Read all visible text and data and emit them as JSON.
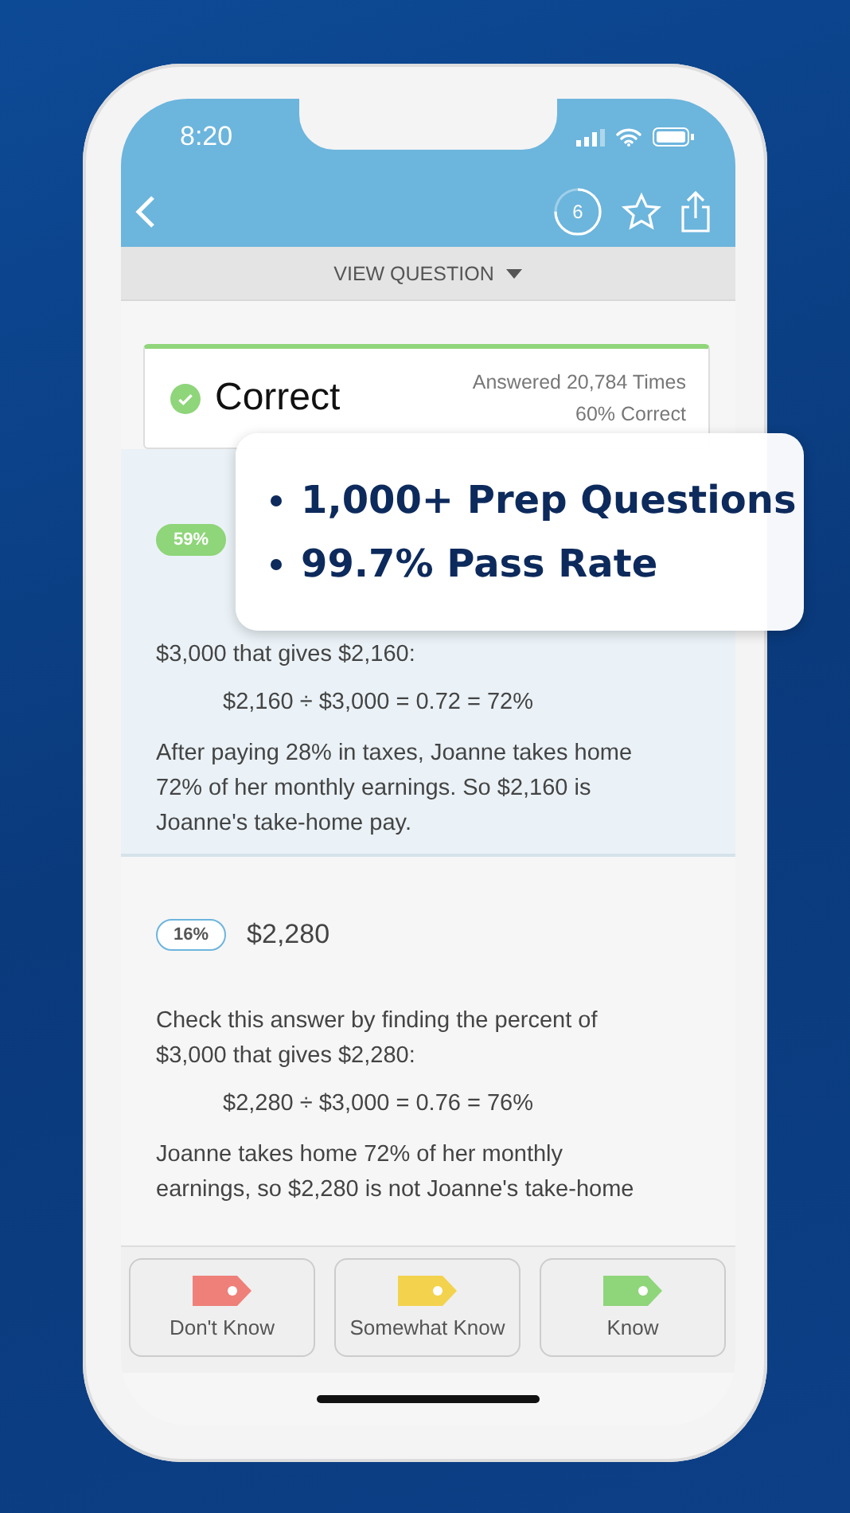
{
  "status_bar": {
    "time": "8:20"
  },
  "nav": {
    "progress_label": "6",
    "level": 0.75
  },
  "view_bar": {
    "label": "VIEW QUESTION"
  },
  "result": {
    "label": "Correct",
    "answered": "Answered 20,784 Times",
    "percent_correct": "60% Correct"
  },
  "answers": [
    {
      "percent": "59%",
      "correct": true,
      "selected": true,
      "check": "$3,000 that gives $2,160:",
      "equation": "$2,160 ÷ $3,000 = 0.72 = 72%",
      "explanation": "After paying 28% in taxes, Joanne takes home 72% of her monthly earnings. So $2,160 is Joanne's take-home pay."
    },
    {
      "percent": "16%",
      "amount": "$2,280",
      "correct": false,
      "selected": false,
      "check": "Check this answer by finding the percent of $3,000 that gives $2,280:",
      "equation": "$2,280 ÷ $3,000 = 0.76 = 76%",
      "explanation": "Joanne takes home 72% of her monthly earnings, so $2,280 is not Joanne's take-home"
    }
  ],
  "callout": {
    "items": [
      "1,000+ Prep Questions",
      "99.7% Pass Rate"
    ]
  },
  "ratings": [
    {
      "label": "Don't Know",
      "color": "#ee8079"
    },
    {
      "label": "Somewhat Know",
      "color": "#f3d24e"
    },
    {
      "label": "Know",
      "color": "#8fd57a"
    }
  ]
}
